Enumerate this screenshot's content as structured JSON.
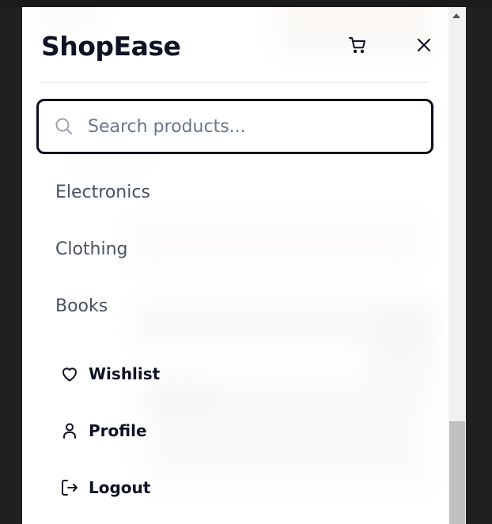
{
  "header": {
    "brand": "ShopEase",
    "cart_icon": "shopping-cart-icon",
    "close_icon": "close-icon"
  },
  "search": {
    "placeholder": "Search products...",
    "value": "",
    "icon": "search-icon"
  },
  "categories": [
    {
      "label": "Electronics"
    },
    {
      "label": "Clothing"
    },
    {
      "label": "Books"
    }
  ],
  "account_links": [
    {
      "label": "Wishlist",
      "icon": "heart-icon"
    },
    {
      "label": "Profile",
      "icon": "user-icon"
    },
    {
      "label": "Logout",
      "icon": "logout-icon"
    }
  ],
  "colors": {
    "text_dark": "#0f1224",
    "text_muted": "#4a5260",
    "search_border": "#0b0f1e"
  }
}
